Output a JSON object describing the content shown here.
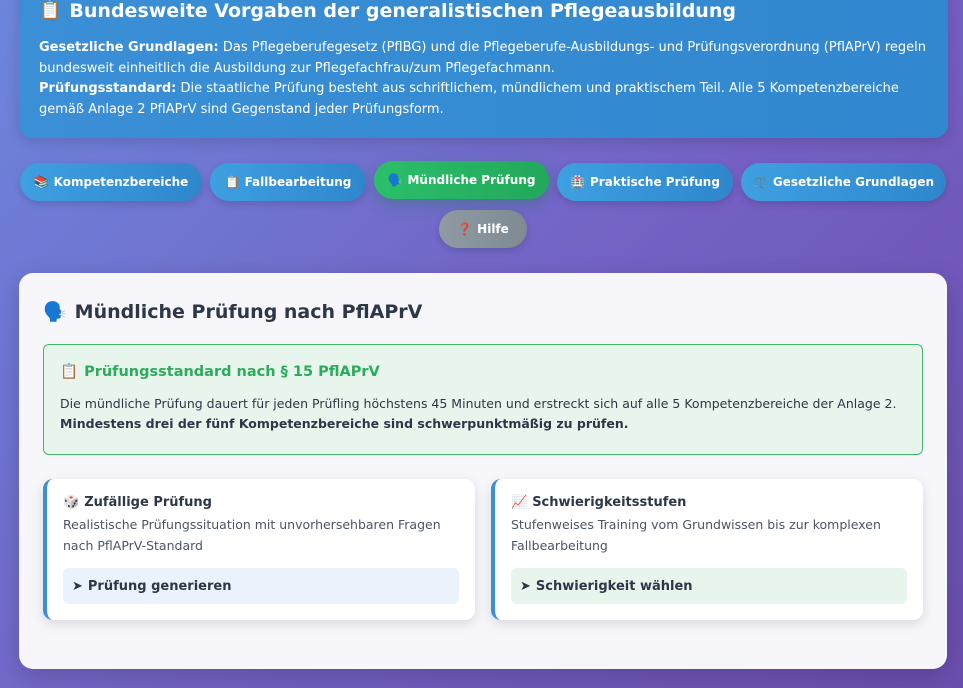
{
  "header": {
    "icon": "📋",
    "title": "Bundesweite Vorgaben der generalistischen Pflegeausbildung",
    "p1_label": "Gesetzliche Grundlagen:",
    "p1_text": " Das Pflegeberufegesetz (PflBG) und die Pflegeberufe-Ausbildungs- und Prüfungsverordnung (PflAPrV) regeln bundesweit einheitlich die Ausbildung zur Pflegefachfrau/zum Pflegefachmann.",
    "p2_label": "Prüfungsstandard:",
    "p2_text": " Die staatliche Prüfung besteht aus schriftlichem, mündlichem und praktischem Teil. Alle 5 Kompetenzbereiche gemäß Anlage 2 PflAPrV sind Gegenstand jeder Prüfungsform."
  },
  "tabs": [
    {
      "icon": "📚",
      "label": "Kompetenzbereiche"
    },
    {
      "icon": "📋",
      "label": "Fallbearbeitung"
    },
    {
      "icon": "🗣️",
      "label": "Mündliche Prüfung"
    },
    {
      "icon": "🏥",
      "label": "Praktische Prüfung"
    },
    {
      "icon": "⚖️",
      "label": "Gesetzliche Grundlagen"
    },
    {
      "icon": "❓",
      "label": "Hilfe"
    }
  ],
  "active_tab": "Mündliche Prüfung",
  "main": {
    "icon": "🗣️",
    "title": "Mündliche Prüfung nach PflAPrV",
    "standard": {
      "icon": "📋",
      "title": "Prüfungsstandard nach § 15 PflAPrV",
      "text": "Die mündliche Prüfung dauert für jeden Prüfling höchstens 45 Minuten und erstreckt sich auf alle 5 Kompetenzbereiche der Anlage 2. ",
      "bold": "Mindestens drei der fünf Kompetenzbereiche sind schwerpunktmäßig zu prüfen."
    },
    "features": [
      {
        "icon": "🎲",
        "title": "Zufällige Prüfung",
        "desc": "Realistische Prüfungssituation mit unvorhersehbaren Fragen nach PflAPrV-Standard",
        "button_icon": "➤",
        "button": "Prüfung generieren"
      },
      {
        "icon": "📈",
        "title": "Schwierigkeitsstufen",
        "desc": "Stufenweises Training vom Grundwissen bis zur komplexen Fallbearbeitung",
        "button_icon": "➤",
        "button": "Schwierigkeit wählen"
      }
    ]
  },
  "colors": {
    "primary": "#3a8fd6",
    "active": "#2bbf6b",
    "help": "#8f9aa3",
    "standard_green": "#2bab5c"
  }
}
